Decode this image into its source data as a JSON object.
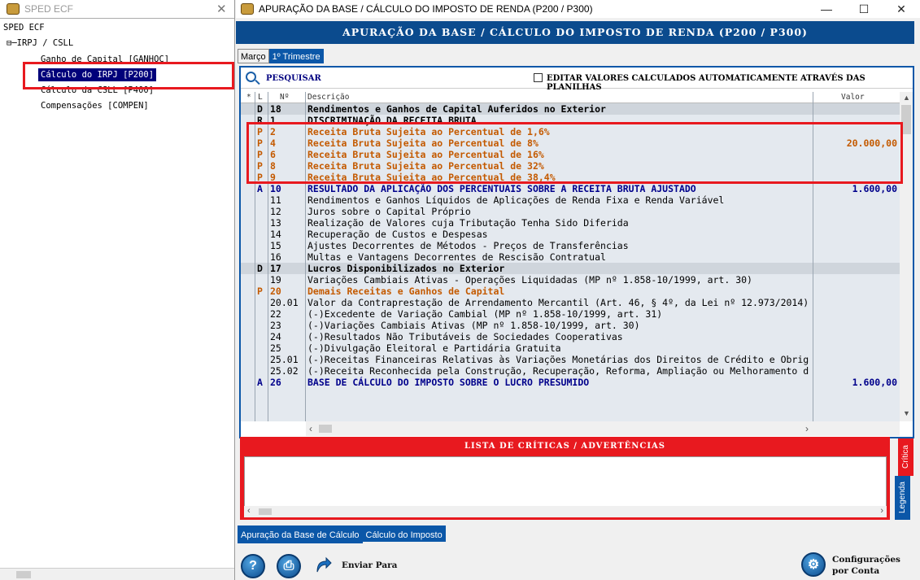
{
  "left": {
    "title": "SPED ECF",
    "tree": [
      {
        "label": "SPED ECF"
      },
      {
        "label": "⊟─IRPJ / CSLL"
      },
      {
        "label": "Ganho de Capital [GANHOC]"
      },
      {
        "label": "Cálculo do IRPJ [P200]"
      },
      {
        "label": "Cálculo da CSLL [P400]"
      },
      {
        "label": "Compensações [COMPEN]"
      }
    ]
  },
  "window": {
    "title": "APURAÇÃO DA BASE / CÁLCULO DO IMPOSTO DE RENDA (P200 / P300)",
    "minimize": "—",
    "maximize": "☐",
    "close": "✕"
  },
  "header": "APURAÇÃO DA BASE / CÁLCULO DO IMPOSTO DE RENDA (P200 / P300)",
  "period_tabs": [
    "Março",
    "1º Trimestre"
  ],
  "search": {
    "label": "PESQUISAR",
    "checkbox_label": "EDITAR VALORES CALCULADOS AUTOMATICAMENTE ATRAVÉS DAS PLANILHAS"
  },
  "grid": {
    "headers": {
      "star": "*",
      "l": "L",
      "n": "Nº",
      "desc": "Descrição",
      "value": "Valor"
    },
    "rows": [
      {
        "l": "D",
        "n": "18",
        "desc": "Rendimentos e Ganhos de Capital Auferidos no Exterior",
        "value": "",
        "style": "bold shade"
      },
      {
        "l": "R",
        "n": "1",
        "desc": "DISCRIMINAÇÃO DA RECEITA BRUTA",
        "value": "",
        "style": "bold"
      },
      {
        "l": "P",
        "n": "2",
        "desc": "Receita Bruta Sujeita ao Percentual de 1,6%",
        "value": "",
        "style": "orange"
      },
      {
        "l": "P",
        "n": "4",
        "desc": "Receita Bruta Sujeita ao Percentual de 8%",
        "value": "20.000,00",
        "style": "orange"
      },
      {
        "l": "P",
        "n": "6",
        "desc": "Receita Bruta Sujeita ao Percentual de 16%",
        "value": "",
        "style": "orange"
      },
      {
        "l": "P",
        "n": "8",
        "desc": "Receita Bruta Sujeita ao Percentual de 32%",
        "value": "",
        "style": "orange"
      },
      {
        "l": "P",
        "n": "9",
        "desc": "Receita Bruta Sujeita ao Percentual de 38,4%",
        "value": "",
        "style": "orange"
      },
      {
        "l": "A",
        "n": "10",
        "desc": "RESULTADO DA APLICAÇÃO DOS PERCENTUAIS SOBRE A RECEITA BRUTA AJUSTADO",
        "value": "1.600,00",
        "style": "blue"
      },
      {
        "l": "",
        "n": "11",
        "desc": "Rendimentos e Ganhos Líquidos de Aplicações de Renda Fixa e Renda Variável",
        "value": "",
        "style": ""
      },
      {
        "l": "",
        "n": "12",
        "desc": "Juros sobre o Capital Próprio",
        "value": "",
        "style": ""
      },
      {
        "l": "",
        "n": "13",
        "desc": "Realização de Valores cuja Tributação Tenha Sido Diferida",
        "value": "",
        "style": ""
      },
      {
        "l": "",
        "n": "14",
        "desc": "Recuperação de Custos e Despesas",
        "value": "",
        "style": ""
      },
      {
        "l": "",
        "n": "15",
        "desc": "Ajustes Decorrentes de Métodos - Preços de Transferências",
        "value": "",
        "style": ""
      },
      {
        "l": "",
        "n": "16",
        "desc": "Multas e Vantagens Decorrentes de Rescisão Contratual",
        "value": "",
        "style": ""
      },
      {
        "l": "D",
        "n": "17",
        "desc": "Lucros Disponibilizados no Exterior",
        "value": "",
        "style": "bold shade"
      },
      {
        "l": "",
        "n": "19",
        "desc": "Variações Cambiais Ativas - Operações Liquidadas (MP nº 1.858-10/1999, art. 30)",
        "value": "",
        "style": ""
      },
      {
        "l": "P",
        "n": "20",
        "desc": "Demais Receitas e Ganhos de Capital",
        "value": "",
        "style": "orange"
      },
      {
        "l": "",
        "n": "20.01",
        "desc": "Valor da Contraprestação de Arrendamento Mercantil (Art. 46, § 4º, da Lei nº 12.973/2014)",
        "value": "",
        "style": ""
      },
      {
        "l": "",
        "n": "22",
        "desc": "(-)Excedente de Variação Cambial (MP nº 1.858-10/1999, art. 31)",
        "value": "",
        "style": ""
      },
      {
        "l": "",
        "n": "23",
        "desc": "(-)Variações Cambiais Ativas (MP nº 1.858-10/1999, art. 30)",
        "value": "",
        "style": ""
      },
      {
        "l": "",
        "n": "24",
        "desc": "(-)Resultados Não Tributáveis de Sociedades Cooperativas",
        "value": "",
        "style": ""
      },
      {
        "l": "",
        "n": "25",
        "desc": "(-)Divulgação Eleitoral e Partidária Gratuita",
        "value": "",
        "style": ""
      },
      {
        "l": "",
        "n": "25.01",
        "desc": "(-)Receitas Financeiras Relativas às Variações Monetárias dos Direitos de Crédito e Obrig",
        "value": "",
        "style": ""
      },
      {
        "l": "",
        "n": "25.02",
        "desc": "(-)Receita Reconhecida pela Construção, Recuperação, Reforma, Ampliação ou Melhoramento d",
        "value": "",
        "style": ""
      },
      {
        "l": "A",
        "n": "26",
        "desc": "BASE DE CÁLCULO DO IMPOSTO SOBRE O LUCRO PRESUMIDO",
        "value": "1.600,00",
        "style": "blue"
      }
    ]
  },
  "criticas": {
    "title": "LISTA DE CRÍTICAS / ADVERTÊNCIAS",
    "side_tab_critica": "Crítica",
    "side_tab_legenda": "Legenda"
  },
  "bottom_tabs": [
    "Apuração da Base de Cálculo",
    "Cálculo do Imposto"
  ],
  "footer": {
    "send_label": "Enviar Para",
    "config_label_1": "Configurações",
    "config_label_2": "por Conta"
  }
}
